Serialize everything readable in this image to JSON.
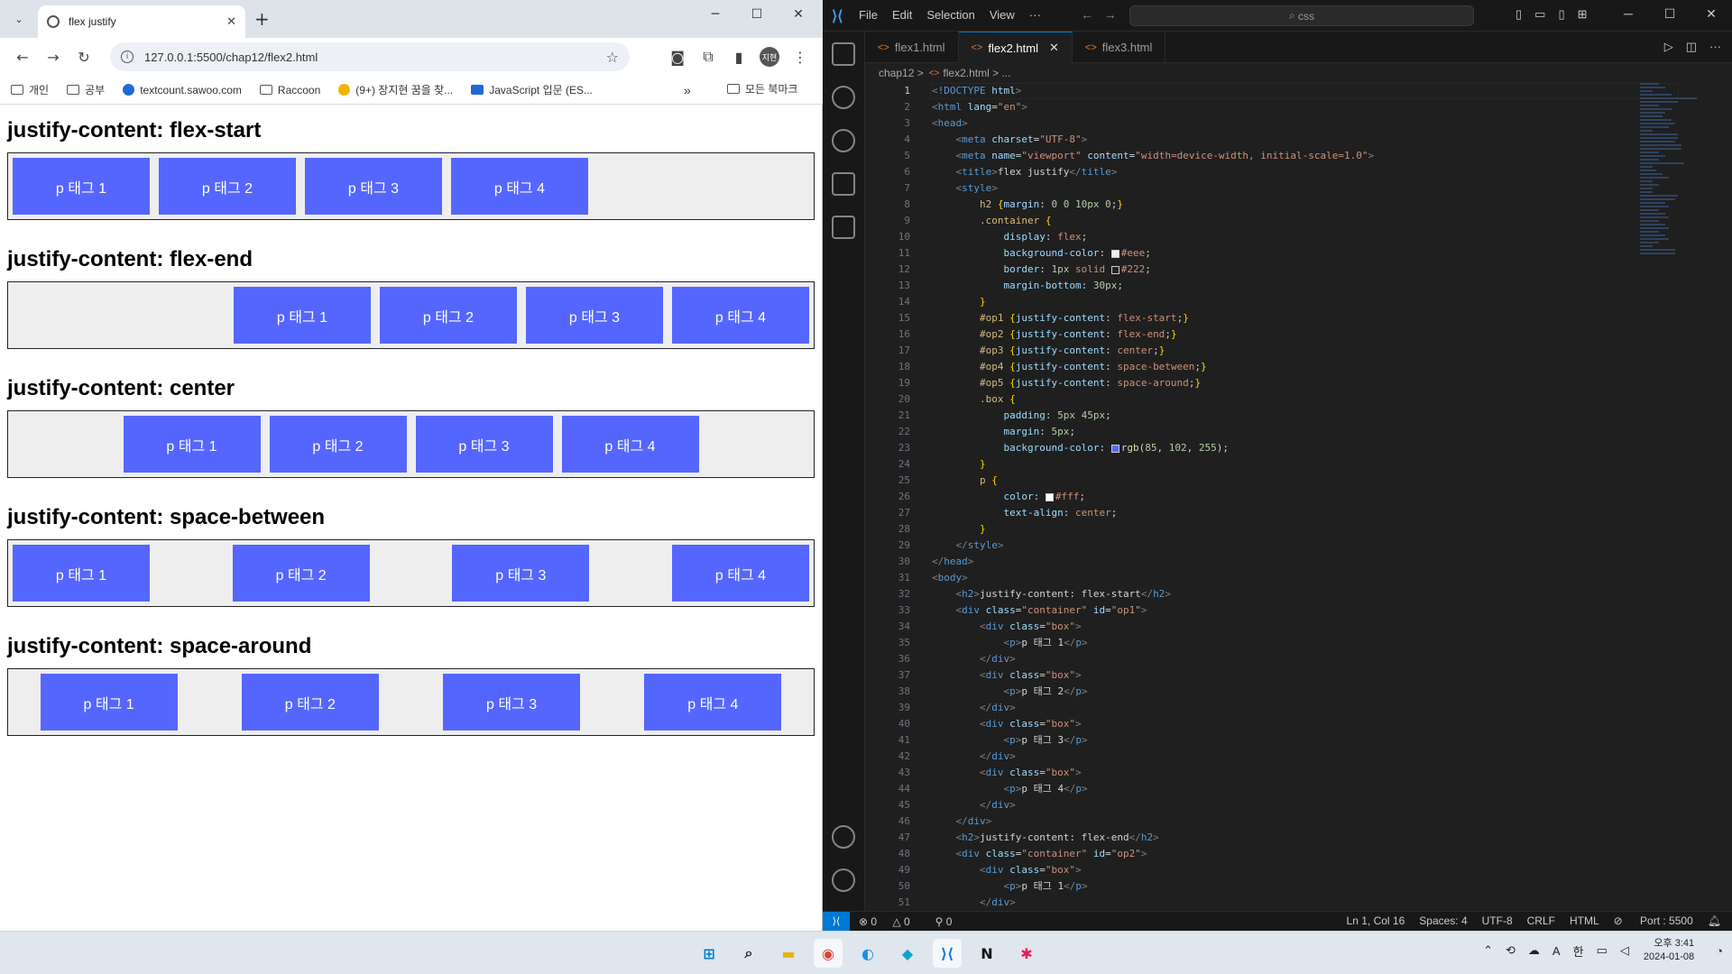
{
  "chrome": {
    "tab_title": "flex justify",
    "url": "127.0.0.1:5500/chap12/flex2.html",
    "profile_initials": "지현",
    "bookmarks": [
      "개인",
      "공부",
      "textcount.sawoo.com",
      "Raccoon",
      "(9+) 장지현 꿈을 찾...",
      "JavaScript 입문 (ES..."
    ],
    "all_bookmarks": "모든 북마크",
    "more": "»"
  },
  "page": {
    "sections": [
      {
        "title": "justify-content: flex-start",
        "id": "op1"
      },
      {
        "title": "justify-content: flex-end",
        "id": "op2"
      },
      {
        "title": "justify-content: center",
        "id": "op3"
      },
      {
        "title": "justify-content: space-between",
        "id": "op4"
      },
      {
        "title": "justify-content: space-around",
        "id": "op5"
      }
    ],
    "box_labels": [
      "p 태그 1",
      "p 태그 2",
      "p 태그 3",
      "p 태그 4"
    ],
    "box_color": "#5566ff"
  },
  "vscode": {
    "menu": [
      "File",
      "Edit",
      "Selection",
      "View",
      "···"
    ],
    "search": "css",
    "tabs": [
      {
        "label": "flex1.html",
        "active": false
      },
      {
        "label": "flex2.html",
        "active": true
      },
      {
        "label": "flex3.html",
        "active": false
      }
    ],
    "breadcrumb_folder": "chap12",
    "breadcrumb_file": "flex2.html",
    "breadcrumb_more": "...",
    "status": {
      "errors": "0",
      "warnings": "0",
      "ports": "0",
      "position": "Ln 1, Col 16",
      "spaces": "Spaces: 4",
      "encoding": "UTF-8",
      "eol": "CRLF",
      "language": "HTML",
      "port": "Port : 5500"
    }
  },
  "taskbar": {
    "time": "오후 3:41",
    "date": "2024-01-08",
    "ime": "한",
    "font": "A"
  }
}
